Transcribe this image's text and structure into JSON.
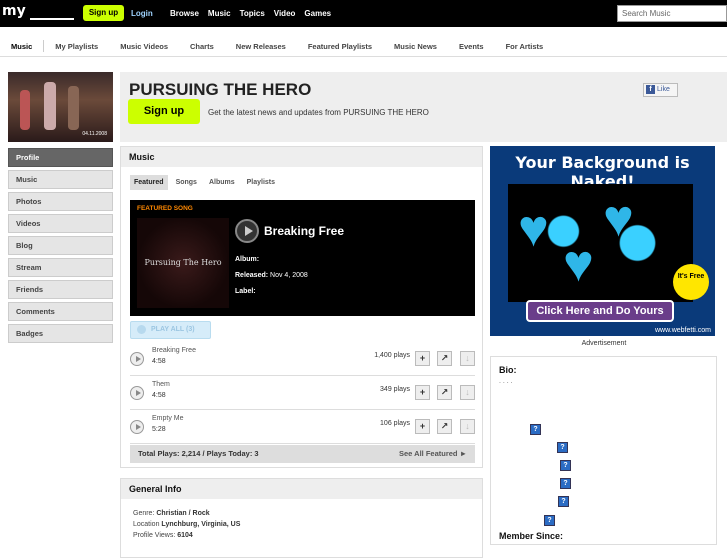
{
  "topbar": {
    "logo": "my",
    "signup": "Sign up",
    "login": "Login",
    "nav": [
      "Browse",
      "Music",
      "Topics",
      "Video",
      "Games"
    ],
    "search_placeholder": "Search Music"
  },
  "subnav": [
    "Music",
    "My Playlists",
    "Music Videos",
    "Charts",
    "New Releases",
    "Featured Playlists",
    "Music News",
    "Events",
    "For Artists"
  ],
  "sidebar": {
    "thumb_date": "04.11.2008",
    "items": [
      "Profile",
      "Music",
      "Photos",
      "Videos",
      "Blog",
      "Stream",
      "Friends",
      "Comments",
      "Badges"
    ]
  },
  "header": {
    "artist": "PURSUING THE HERO",
    "like": "Like",
    "signup": "Sign up",
    "promo": "Get the latest news and updates from PURSUING THE HERO"
  },
  "music": {
    "title": "Music",
    "tabs": [
      "Featured",
      "Songs",
      "Albums",
      "Playlists"
    ],
    "featured_label": "FEATURED SONG",
    "album_art_text": "Pursuing The Hero",
    "featured_title": "Breaking Free",
    "album_label": "Album:",
    "released_label": "Released:",
    "released_value": "Nov 4, 2008",
    "label_label": "Label:",
    "play_all": "PLAY ALL (3)",
    "tracks": [
      {
        "name": "Breaking Free",
        "duration": "4:58",
        "plays": "1,400 plays"
      },
      {
        "name": "Them",
        "duration": "4:58",
        "plays": "349 plays"
      },
      {
        "name": "Empty Me",
        "duration": "5:28",
        "plays": "106 plays"
      }
    ],
    "totals": "Total Plays: 2,214 / Plays Today: 3",
    "see_all": "See All Featured ►"
  },
  "general": {
    "title": "General Info",
    "genre_label": "Genre:",
    "genre_value": "Christian / Rock",
    "location_label": "Location",
    "location_value": "Lynchburg, Virginia, US",
    "views_label": "Profile Views:",
    "views_value": "6104"
  },
  "ad": {
    "title": "Your Background is Naked!",
    "cta": "Click Here and Do Yours",
    "free": "It's Free",
    "url": "www.webfetti.com",
    "label": "Advertisement"
  },
  "bio": {
    "title": "Bio:",
    "dots": ". . . .",
    "member_since": "Member Since:"
  }
}
